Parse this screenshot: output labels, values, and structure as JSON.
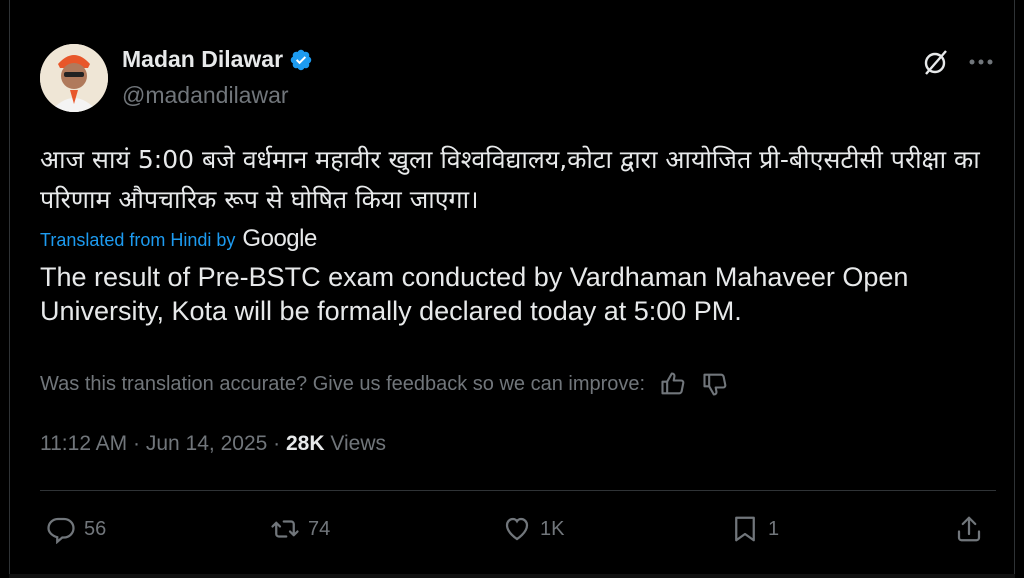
{
  "author": {
    "name": "Madan Dilawar",
    "handle": "@madandilawar"
  },
  "post": {
    "original_text": "आज सायं 5:00 बजे वर्धमान महावीर खुला विश्वविद्यालय,कोटा द्वारा आयोजित प्री-बीएसटीसी परीक्षा का परिणाम औपचारिक रूप से घोषित किया जाएगा।",
    "translated_label": "Translated from Hindi by",
    "translator_brand": "Google",
    "translated_text": "The result of Pre-BSTC exam conducted by Vardhaman Mahaveer Open University, Kota will be formally declared today at 5:00 PM.",
    "feedback_prompt": "Was this translation accurate? Give us feedback so we can improve:",
    "time": "11:12 AM",
    "date": "Jun 14, 2025",
    "separator": "·",
    "views_count": "28K",
    "views_label": "Views"
  },
  "actions": {
    "replies": "56",
    "reposts": "74",
    "likes": "1K",
    "bookmarks": "1"
  },
  "colors": {
    "background": "#000000",
    "text": "#e7e9ea",
    "muted": "#71767b",
    "link": "#1d9bf0",
    "verified": "#1d9bf0"
  },
  "icons": [
    "verified-badge-icon",
    "grok-icon",
    "more-icon",
    "thumbs-up-icon",
    "thumbs-down-icon",
    "reply-icon",
    "repost-icon",
    "like-icon",
    "bookmark-icon",
    "share-icon"
  ]
}
